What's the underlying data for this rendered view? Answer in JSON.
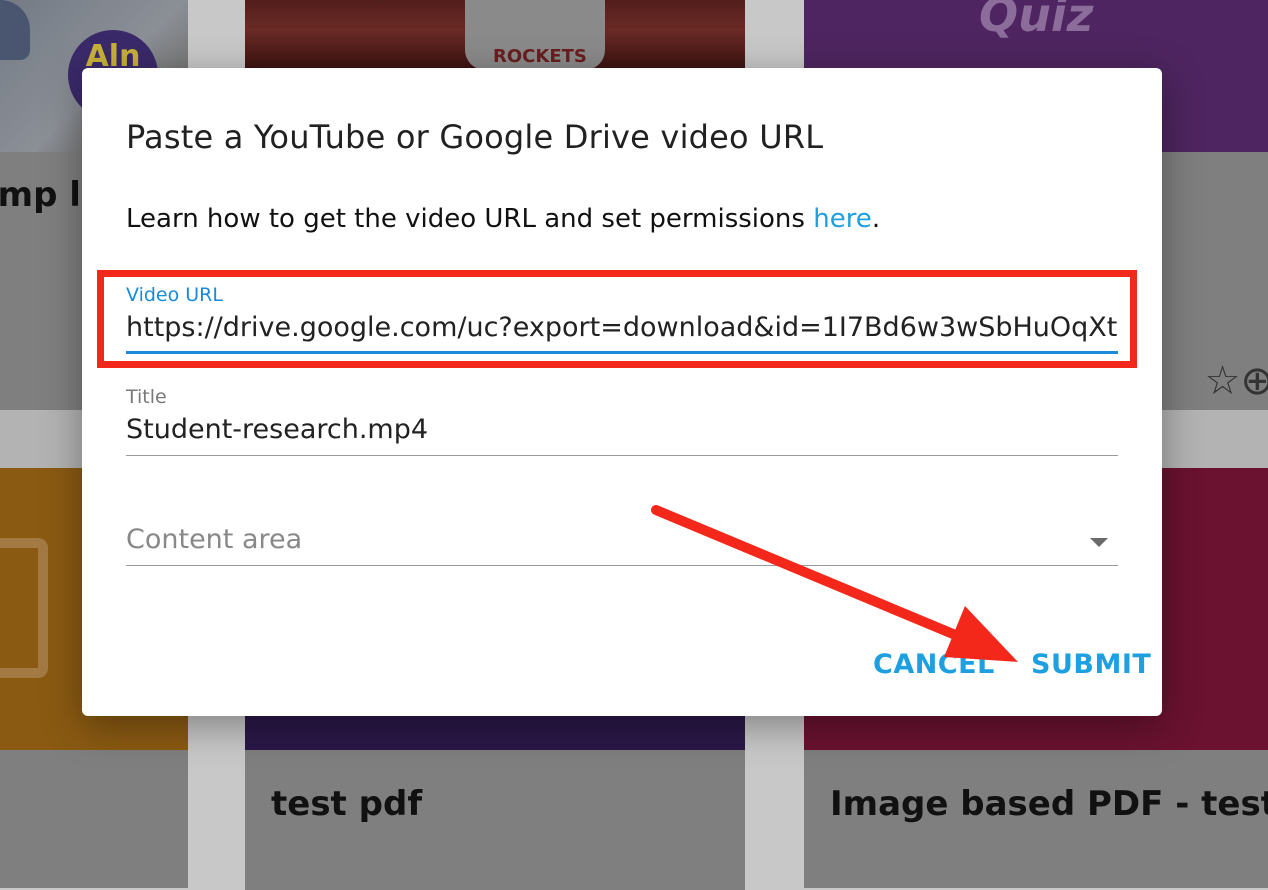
{
  "background": {
    "card_a_caption": "imp l",
    "card_a_badge": "Aln",
    "card_b_jersey": "ROCKETS",
    "card_c_thumb_text": "Quiz",
    "card_c_actions": "☆⊕",
    "card_e_caption": "test pdf",
    "card_f_caption": "Image based PDF - test"
  },
  "dialog": {
    "title": "Paste a YouTube or Google Drive video URL",
    "help_prefix": "Learn how to get the video URL and set permissions ",
    "help_link": "here",
    "help_suffix": ".",
    "fields": {
      "url": {
        "label": "Video URL",
        "value": "https://drive.google.com/uc?export=download&id=1I7Bd6w3wSbHuOqXt"
      },
      "title": {
        "label": "Title",
        "value": "Student-research.mp4"
      },
      "content_area": {
        "placeholder": "Content area"
      }
    },
    "buttons": {
      "cancel": "CANCEL",
      "submit": "SUBMIT"
    }
  },
  "colors": {
    "accent": "#1ea0e0",
    "highlight": "#f4271b"
  }
}
